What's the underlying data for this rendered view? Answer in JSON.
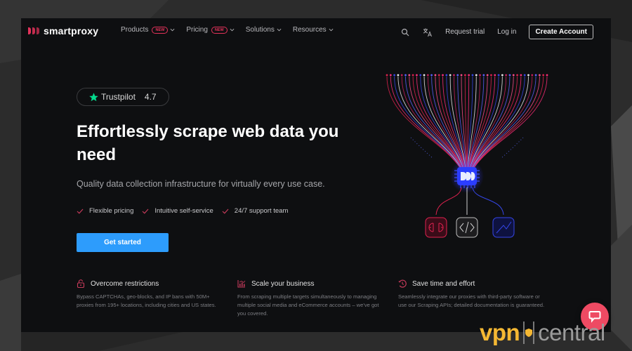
{
  "brand": {
    "name": "smartproxy",
    "accent": "#e3325a",
    "cta_color": "#2d9cfc"
  },
  "nav": {
    "links": [
      {
        "label": "Products",
        "badge": "NEW"
      },
      {
        "label": "Pricing",
        "badge": "NEW"
      },
      {
        "label": "Solutions"
      },
      {
        "label": "Resources"
      }
    ],
    "search_icon": "search-icon",
    "language_icon": "translate-icon",
    "request_trial": "Request trial",
    "login": "Log in",
    "create_account": "Create Account"
  },
  "hero": {
    "trustpilot": {
      "label": "Trustpilot",
      "rating": "4.7",
      "icon": "star-icon"
    },
    "title": "Effortlessly scrape web data you need",
    "subtitle": "Quality data collection infrastructure for virtually every use case.",
    "features": [
      "Flexible pricing",
      "Intuitive self-service",
      "24/7 support team"
    ],
    "cta": "Get started"
  },
  "cards": [
    {
      "icon": "unlock-icon",
      "title": "Overcome restrictions",
      "body": "Bypass CAPTCHAs, geo-blocks, and IP bans with 50M+ proxies from 195+ locations, including cities and US states."
    },
    {
      "icon": "chart-icon",
      "title": "Scale your business",
      "body": "From scraping multiple targets simultaneously to managing multiple social media and eCommerce accounts – we've got you covered."
    },
    {
      "icon": "clock-icon",
      "title": "Save time and effort",
      "body": "Seamlessly integrate our proxies with third-party software or use our Scraping APIs; detailed documentation is guaranteed."
    }
  ],
  "chat": {
    "icon": "chat-icon"
  },
  "watermark": {
    "part1": "vpn",
    "part2": "central"
  }
}
